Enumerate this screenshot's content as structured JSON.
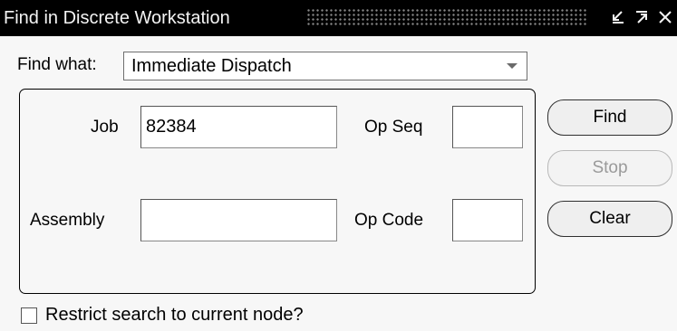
{
  "window": {
    "title": "Find in Discrete Workstation",
    "buttons": [
      "minimize",
      "maximize",
      "close"
    ]
  },
  "find_what": {
    "label": "Find what:",
    "selected": "Immediate Dispatch"
  },
  "fields": {
    "job": {
      "label": "Job",
      "value": "82384"
    },
    "op_seq": {
      "label": "Op Seq",
      "value": ""
    },
    "assembly": {
      "label": "Assembly",
      "value": ""
    },
    "op_code": {
      "label": "Op Code",
      "value": ""
    }
  },
  "buttons": {
    "find": "Find",
    "stop": "Stop",
    "clear": "Clear"
  },
  "restrict_checkbox": {
    "label": "Restrict search to current node?",
    "checked": false
  },
  "icons": {
    "minimize": "minimize-icon",
    "maximize": "maximize-icon",
    "close": "close-icon",
    "dropdown": "chevron-down-icon"
  }
}
